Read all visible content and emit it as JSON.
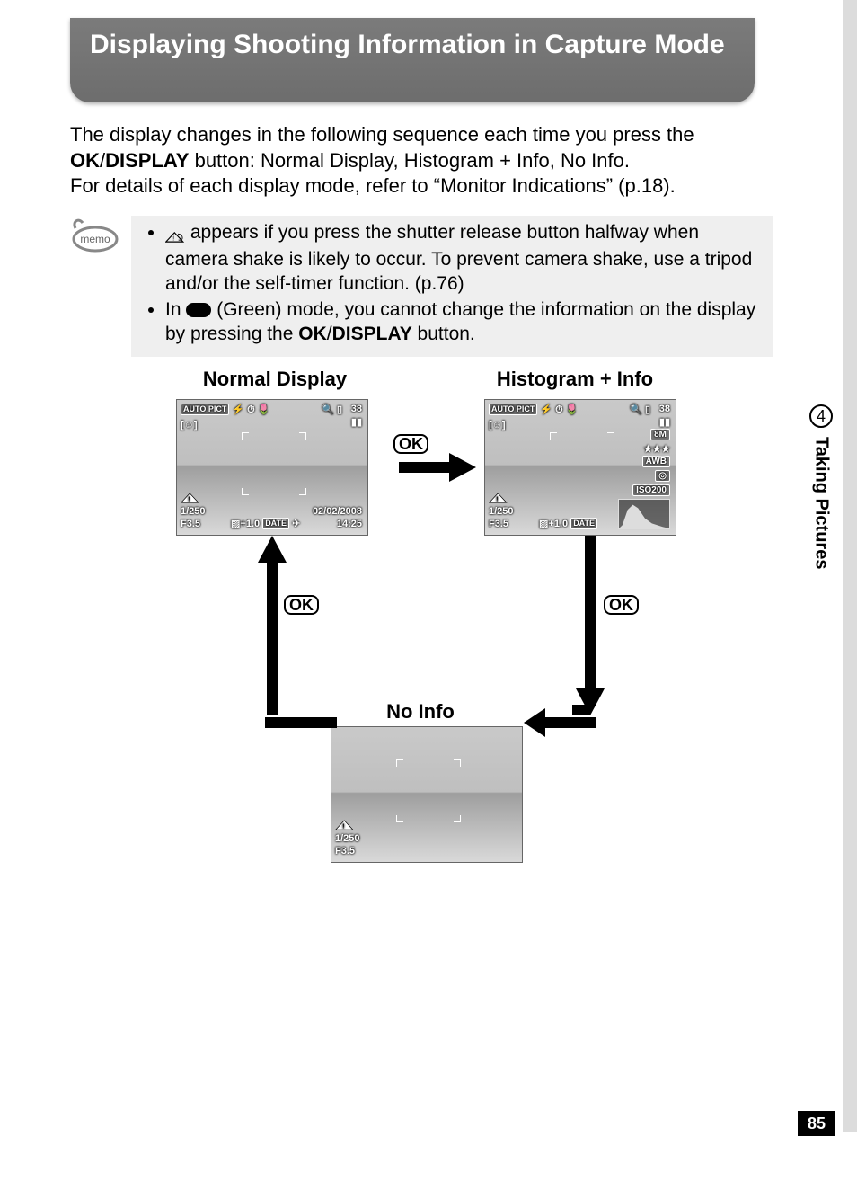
{
  "heading": "Displaying Shooting Information in Capture Mode",
  "intro": {
    "l1a": "The display changes in the following sequence each time you press the ",
    "ok": "OK",
    "slash": "/",
    "display": "DISPLAY",
    "l1b": " button: Normal Display, Histogram + Info, No Info.",
    "l2": "For details of each display mode, refer to “Monitor Indications” (p.18)."
  },
  "memo": {
    "b1a": " appears if you press the shutter release button halfway when camera shake is likely to occur. To prevent camera shake, use a tripod and/or the self-timer function. (p.76)",
    "b2a": "In ",
    "b2b": " (Green) mode, you cannot change the information on the display by pressing the ",
    "ok": "OK",
    "slash": "/",
    "display": "DISPLAY",
    "b2c": " button."
  },
  "labels": {
    "normal": "Normal Display",
    "hist": "Histogram + Info",
    "noinfo": "No Info"
  },
  "screens": {
    "normal": {
      "top_icons": "AUTO PICT",
      "count": "38",
      "shutter": "1/250",
      "aperture": "F3.5",
      "ev": "+1.0",
      "date_mark": "DATE",
      "date": "02/02/2008",
      "time": "14:25"
    },
    "hist": {
      "count": "38",
      "res": "8M",
      "stars": "★★★",
      "awb": "AWB",
      "iso": "ISO200",
      "shutter": "1/250",
      "aperture": "F3.5",
      "ev": "+1.0",
      "date_mark": "DATE"
    },
    "noinfo": {
      "shutter": "1/250",
      "aperture": "F3.5"
    }
  },
  "ok_label": "OK",
  "side": {
    "num": "4",
    "text": "Taking Pictures"
  },
  "page_number": "85"
}
